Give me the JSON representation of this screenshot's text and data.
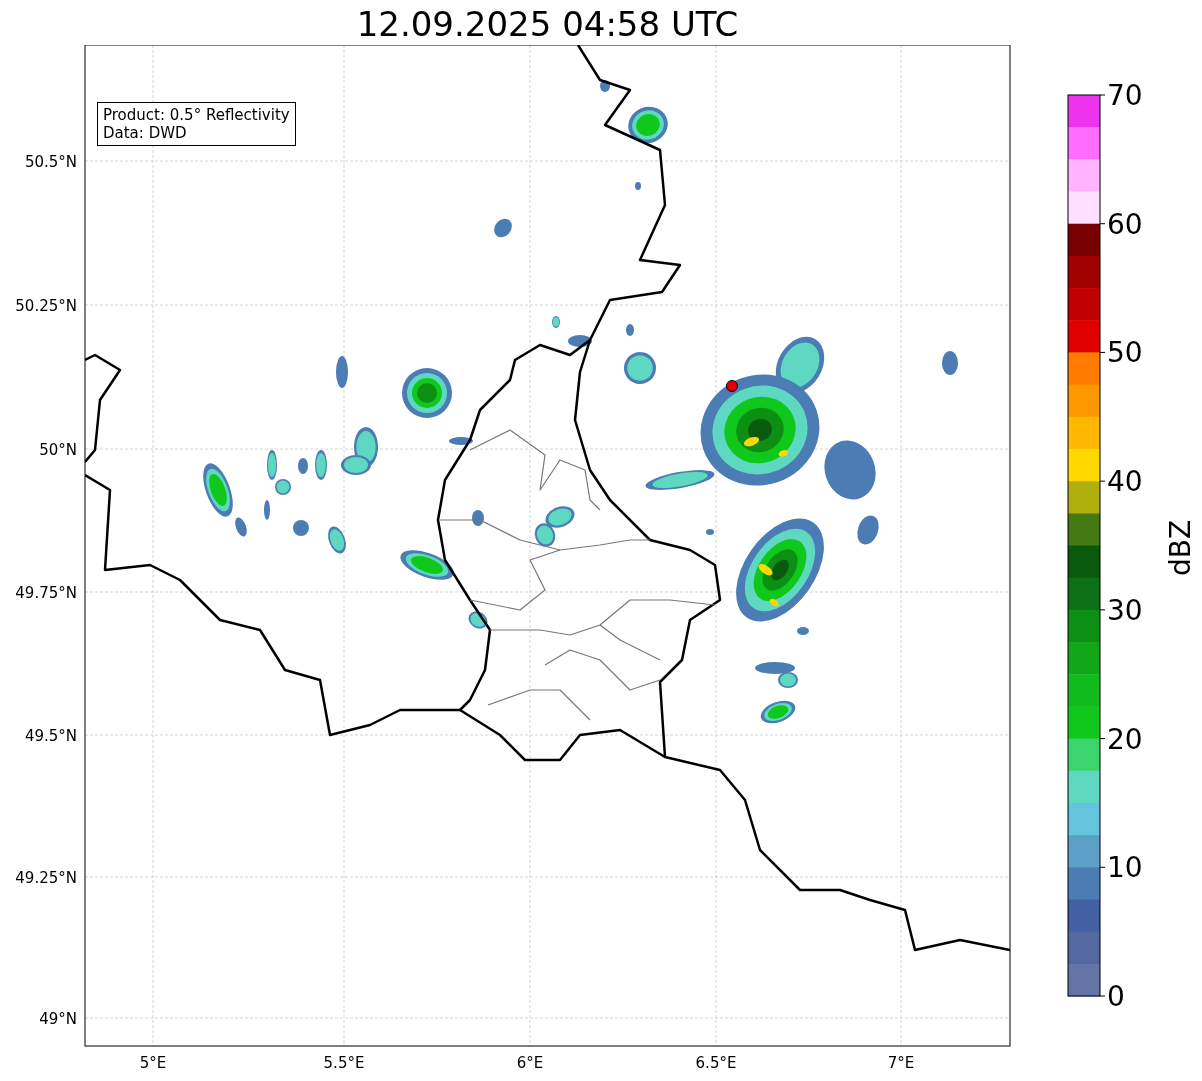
{
  "title": "12.09.2025 04:58 UTC",
  "legend": [
    "Product: 0.5° Reflectivity",
    "Data: DWD"
  ],
  "map": {
    "latitude_labels": [
      "50.5°N",
      "50.25°N",
      "50°N",
      "49.75°N",
      "49.5°N",
      "49.25°N",
      "49°N"
    ],
    "longitude_labels": [
      "5°E",
      "5.5°E",
      "6°E",
      "6.5°E",
      "7°E"
    ]
  },
  "colorbar": {
    "label": "dBZ",
    "ticks": [
      "70",
      "60",
      "50",
      "40",
      "30",
      "20",
      "10",
      "0"
    ],
    "segments": [
      {
        "color": "#ee33ee"
      },
      {
        "color": "#ff6cff"
      },
      {
        "color": "#ffb4ff"
      },
      {
        "color": "#ffe0ff"
      },
      {
        "color": "#780000"
      },
      {
        "color": "#a00000"
      },
      {
        "color": "#c00000"
      },
      {
        "color": "#e00000"
      },
      {
        "color": "#ff7c00"
      },
      {
        "color": "#ff9800"
      },
      {
        "color": "#ffb800"
      },
      {
        "color": "#ffd800"
      },
      {
        "color": "#b0b00c"
      },
      {
        "color": "#447810"
      },
      {
        "color": "#0a5a0e"
      },
      {
        "color": "#0c7014"
      },
      {
        "color": "#0c9014"
      },
      {
        "color": "#10a818"
      },
      {
        "color": "#10bc1c"
      },
      {
        "color": "#10c81c"
      },
      {
        "color": "#3cd46c"
      },
      {
        "color": "#5ed8c0"
      },
      {
        "color": "#64c4dc"
      },
      {
        "color": "#5ca0c8"
      },
      {
        "color": "#4c7cb4"
      },
      {
        "color": "#4460a4"
      },
      {
        "color": "#5468a0"
      },
      {
        "color": "#6474a4"
      }
    ]
  }
}
